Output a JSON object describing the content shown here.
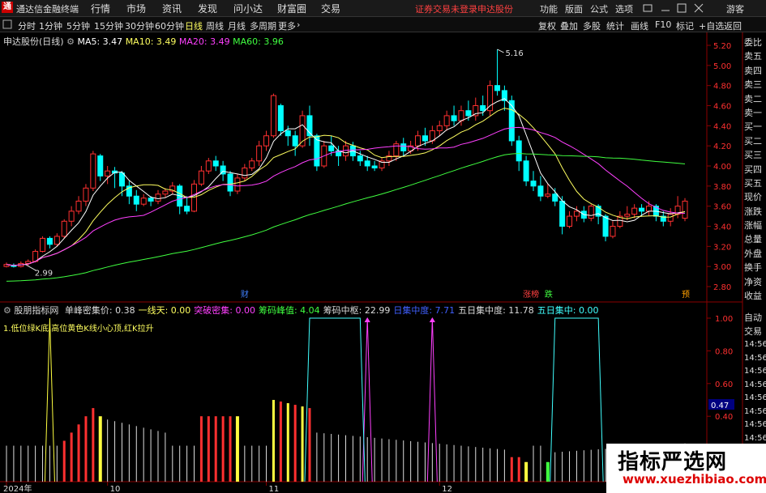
{
  "titlebar": {
    "app_title": "通达信金融终端",
    "menus": [
      "行情",
      "市场",
      "资讯",
      "发现",
      "问小达",
      "财富圈",
      "交易"
    ],
    "warning": "证券交易未登录",
    "stock_name": "申达股份",
    "right_menus": [
      "功能",
      "版面",
      "公式",
      "选项"
    ],
    "guest": "游客"
  },
  "toolbar": {
    "periods": [
      "分时",
      "1分钟",
      "5分钟",
      "15分钟",
      "30分钟",
      "60分钟",
      "日线",
      "周线",
      "月线",
      "多周期",
      "更多"
    ],
    "selected_period": "日线",
    "right_tools": [
      "复权",
      "叠加",
      "多股",
      "统计",
      "画线",
      "F10",
      "标记",
      "+自选",
      "返回"
    ]
  },
  "legend_main": {
    "name": "申达股份(日线)",
    "ma5": "MA5: 3.47",
    "ma10": "MA10: 3.49",
    "ma20": "MA20: 3.49",
    "ma60": "MA60: 3.96"
  },
  "legend_ind": {
    "name": "股朋指标网",
    "items": [
      {
        "label": "单峰密集价: 0.38",
        "color": "#dddddd"
      },
      {
        "label": "一线天: 0.00",
        "color": "#ffff60"
      },
      {
        "label": "突破密集: 0.00",
        "color": "#ff40ff"
      },
      {
        "label": "筹码峰值: 4.04",
        "color": "#40ff40"
      },
      {
        "label": "筹码中枢: 22.99",
        "color": "#dddddd"
      },
      {
        "label": "日集中度: 7.71",
        "color": "#4060ff"
      },
      {
        "label": "五日集中度: 11.78",
        "color": "#dddddd"
      },
      {
        "label": "五日集中: 0.00",
        "color": "#40ffff"
      }
    ],
    "note": "1.低位绿K底,高位黄色K线小心顶,红K拉升"
  },
  "price_axis": [
    "5.20",
    "5.00",
    "4.80",
    "4.60",
    "4.40",
    "4.20",
    "4.00",
    "3.80",
    "3.60",
    "3.40",
    "3.20",
    "3.00",
    "2.80"
  ],
  "ind_axis": [
    "1.00",
    "0.80",
    "0.60",
    "0.40",
    "0.20"
  ],
  "ind_current": "0.47",
  "annotations": {
    "high": "5.16",
    "low": "2.99",
    "marks": [
      {
        "label": "财",
        "color": "#4080ff"
      },
      {
        "label": "涨榜",
        "color": "#ff4040"
      },
      {
        "label": "跌",
        "color": "#40ff40"
      },
      {
        "label": "预",
        "color": "#ffa000"
      }
    ]
  },
  "right_panel_top": [
    "委比",
    "卖五",
    "卖四",
    "卖三",
    "卖二",
    "卖一",
    "买一",
    "买二",
    "买三",
    "买四",
    "买五",
    "现价",
    "涨跌",
    "涨幅",
    "总量",
    "外盘",
    "换手",
    "净资",
    "收益"
  ],
  "right_panel_bottom": [
    "自动",
    "交易",
    "14:56",
    "14:56",
    "14:56",
    "14:56",
    "14:56",
    "14:56",
    "14:56",
    "14:56",
    "14:56",
    "14:56"
  ],
  "x_axis": [
    "2024年",
    "10",
    "11",
    "12",
    "1"
  ],
  "watermark": {
    "title": "指标严选网",
    "url": "www.xuezhibiao.com"
  },
  "colors": {
    "up": "#ff3030",
    "down": "#00ffff",
    "ma5": "#ffffff",
    "ma10": "#ffff60",
    "ma20": "#ff40ff",
    "ma60": "#40ff40"
  }
}
